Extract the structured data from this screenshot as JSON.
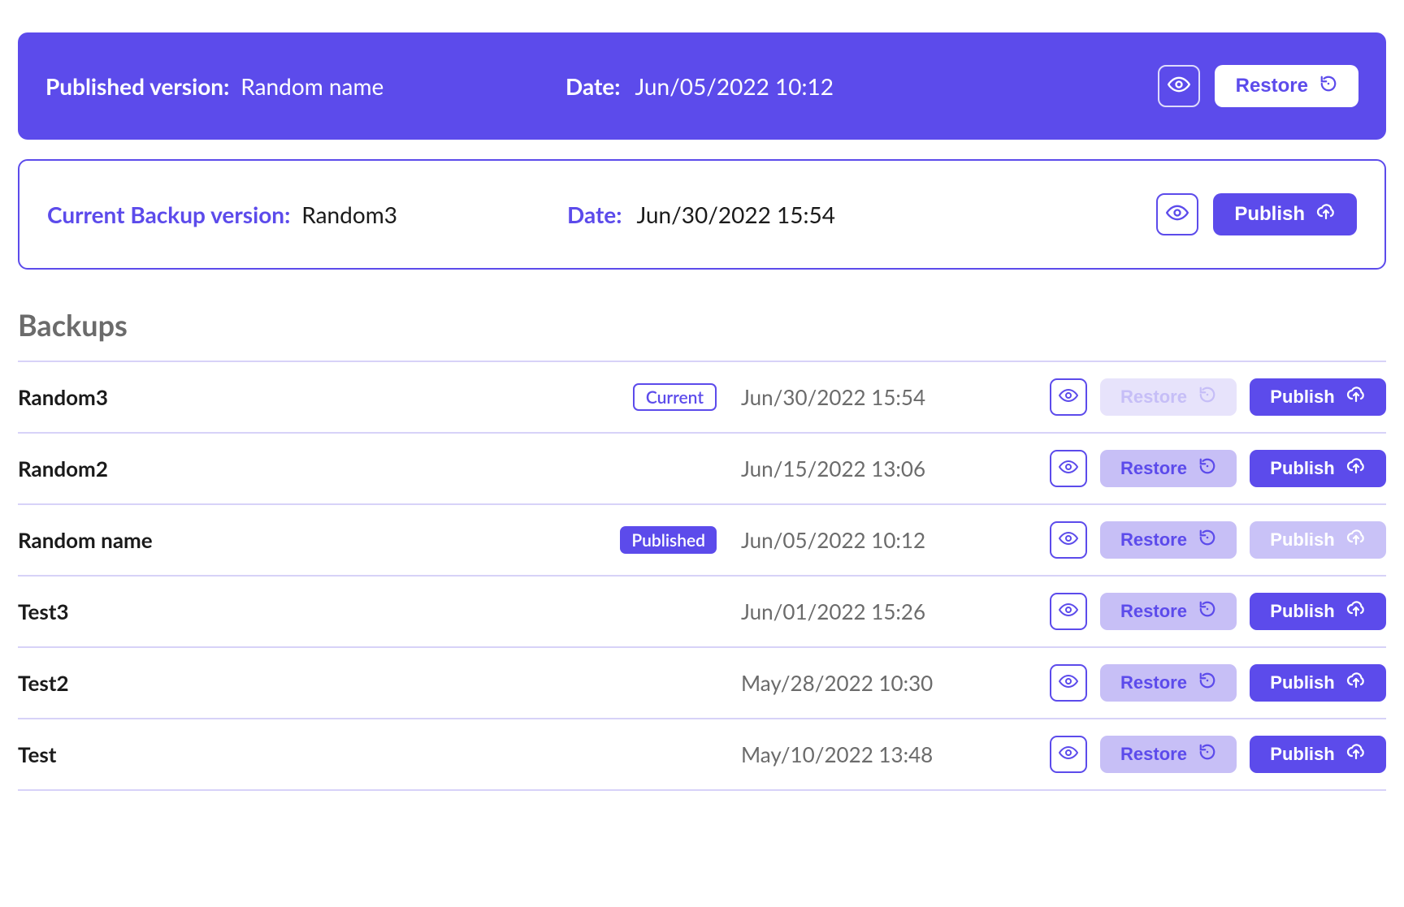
{
  "published": {
    "label": "Published version:",
    "name": "Random name",
    "date_label": "Date:",
    "date": "Jun/05/2022 10:12",
    "restore_label": "Restore"
  },
  "current": {
    "label": "Current Backup version:",
    "name": "Random3",
    "date_label": "Date:",
    "date": "Jun/30/2022 15:54",
    "publish_label": "Publish"
  },
  "section_title": "Backups",
  "badges": {
    "current": "Current",
    "published": "Published"
  },
  "buttons": {
    "restore": "Restore",
    "publish": "Publish"
  },
  "backups": [
    {
      "name": "Random3",
      "date": "Jun/30/2022 15:54",
      "badge": "current",
      "restore_enabled": false,
      "publish_enabled": true
    },
    {
      "name": "Random2",
      "date": "Jun/15/2022 13:06",
      "badge": null,
      "restore_enabled": true,
      "publish_enabled": true
    },
    {
      "name": "Random name",
      "date": "Jun/05/2022 10:12",
      "badge": "published",
      "restore_enabled": true,
      "publish_enabled": false
    },
    {
      "name": "Test3",
      "date": "Jun/01/2022 15:26",
      "badge": null,
      "restore_enabled": true,
      "publish_enabled": true
    },
    {
      "name": "Test2",
      "date": "May/28/2022 10:30",
      "badge": null,
      "restore_enabled": true,
      "publish_enabled": true
    },
    {
      "name": "Test",
      "date": "May/10/2022 13:48",
      "badge": null,
      "restore_enabled": true,
      "publish_enabled": true
    }
  ]
}
